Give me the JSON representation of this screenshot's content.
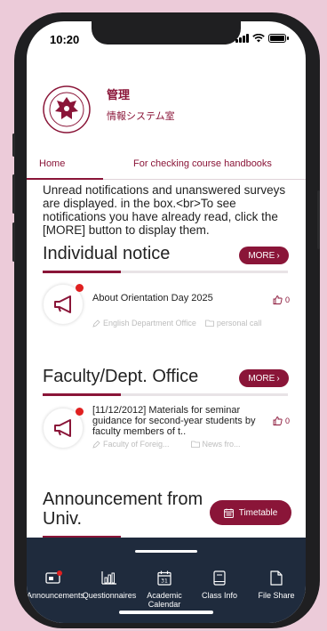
{
  "status_bar": {
    "time": "10:20"
  },
  "header": {
    "title": "管理",
    "subtitle": "情報システム室"
  },
  "tabs": [
    {
      "label": "Home",
      "active": true
    },
    {
      "label": "For checking course handbooks",
      "active": false
    }
  ],
  "intro_text": "Unread notifications and unanswered surveys are displayed. in the box.<br>To see notifications you have already read, click the [MORE] button to display them.",
  "sections": {
    "individual": {
      "title": "Individual notice",
      "more_label": "MORE",
      "items": [
        {
          "title": "About Orientation Day 2025",
          "author": "English Department Office",
          "category": "personal call",
          "likes": "0",
          "unread": true
        }
      ]
    },
    "faculty": {
      "title": "Faculty/Dept. Office",
      "more_label": "MORE",
      "items": [
        {
          "title": "[11/12/2012] Materials for seminar guidance for second-year students by faculty members of t..",
          "author": "Faculty of Foreig...",
          "category": "News fro...",
          "likes": "0",
          "unread": true
        }
      ]
    },
    "announcement": {
      "title_line1": "Announcement from",
      "title_line2": "Univ.",
      "timetable_label": "Timetable"
    }
  },
  "bottom_nav": [
    {
      "label": "Announcements",
      "icon": "announcement-icon"
    },
    {
      "label": "Questionnaires",
      "icon": "chart-icon"
    },
    {
      "label": "Academic Calendar",
      "icon": "calendar-icon"
    },
    {
      "label": "Class Info",
      "icon": "book-icon"
    },
    {
      "label": "File Share",
      "icon": "file-icon"
    }
  ],
  "colors": {
    "accent": "#8a1538",
    "nav_bg": "#1f2b3d",
    "unread_dot": "#e02020",
    "page_bg": "#eccbd9"
  }
}
